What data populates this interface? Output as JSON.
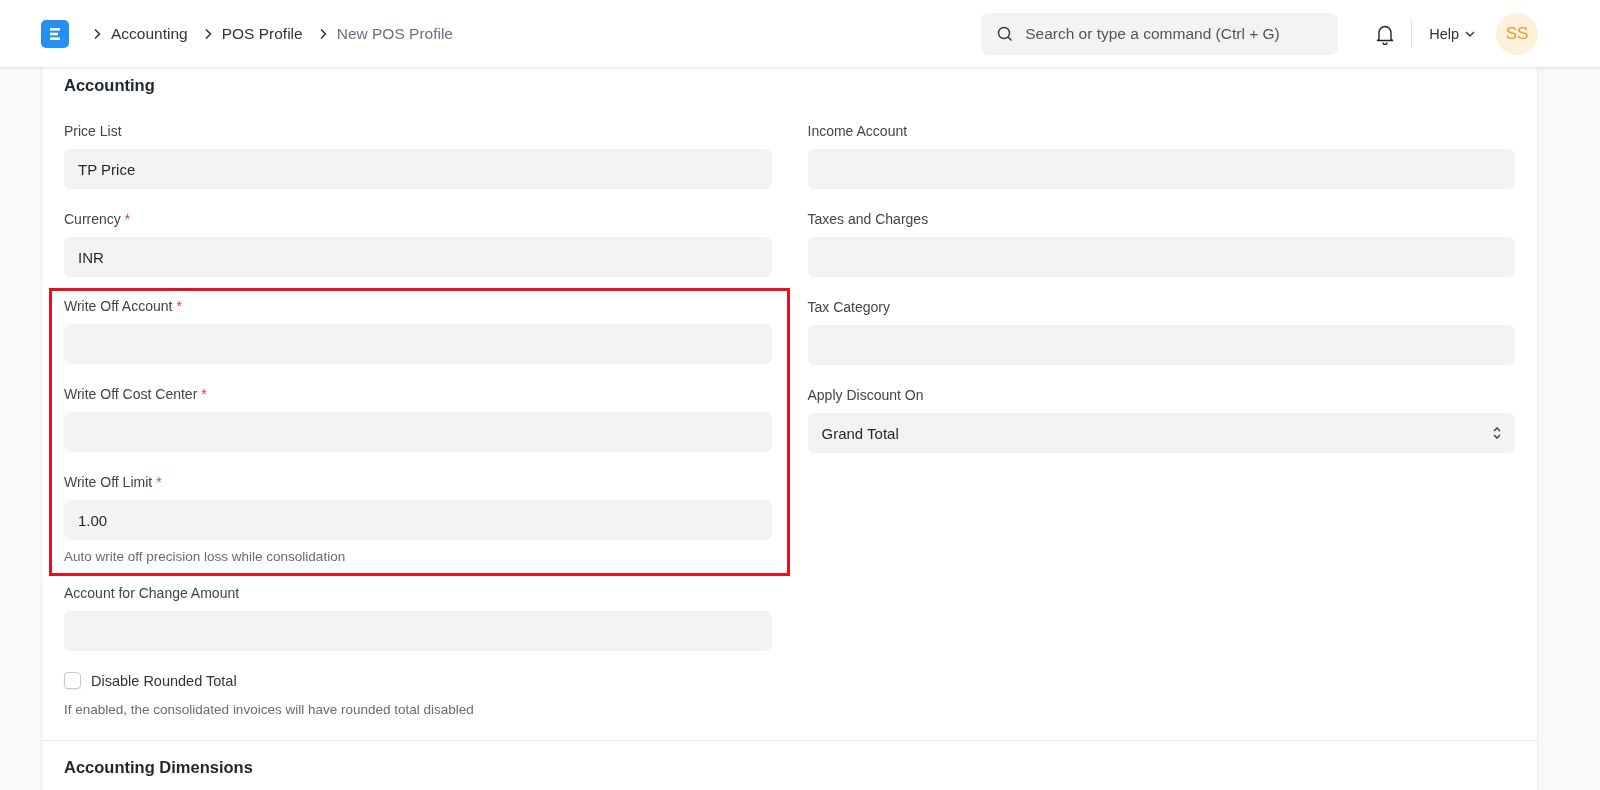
{
  "navbar": {
    "breadcrumbs": [
      {
        "label": "Accounting",
        "current": false
      },
      {
        "label": "POS Profile",
        "current": false
      },
      {
        "label": "New POS Profile",
        "current": true
      }
    ],
    "search": {
      "placeholder": "Search or type a command (Ctrl + G)"
    },
    "help": {
      "label": "Help"
    },
    "avatar": {
      "initials": "SS"
    }
  },
  "section": {
    "title": "Accounting",
    "left": [
      {
        "kind": "field",
        "label": "Price List",
        "value": "TP Price"
      },
      {
        "kind": "field",
        "label": "Currency",
        "required_mark": "*",
        "value": "INR"
      },
      {
        "kind": "highlight",
        "children": [
          {
            "kind": "field",
            "label": "Write Off Account",
            "required_mark": "*"
          },
          {
            "kind": "field",
            "label": "Write Off Cost Center",
            "required_mark": "*"
          },
          {
            "kind": "field",
            "label": "Write Off Limit",
            "required_mark": "*",
            "value": "1.00",
            "description": "Auto write off precision loss while consolidation"
          }
        ]
      },
      {
        "kind": "field",
        "label": "Account for Change Amount"
      },
      {
        "kind": "checkbox",
        "label": "Disable Rounded Total",
        "checked": false,
        "description": "If enabled, the consolidated invoices will have rounded total disabled"
      }
    ],
    "right": [
      {
        "kind": "field",
        "label": "Income Account"
      },
      {
        "kind": "field",
        "label": "Taxes and Charges"
      },
      {
        "kind": "field",
        "label": "Tax Category"
      },
      {
        "kind": "select",
        "label": "Apply Discount On",
        "value": "Grand Total"
      }
    ]
  },
  "next_section": {
    "title": "Accounting Dimensions"
  }
}
